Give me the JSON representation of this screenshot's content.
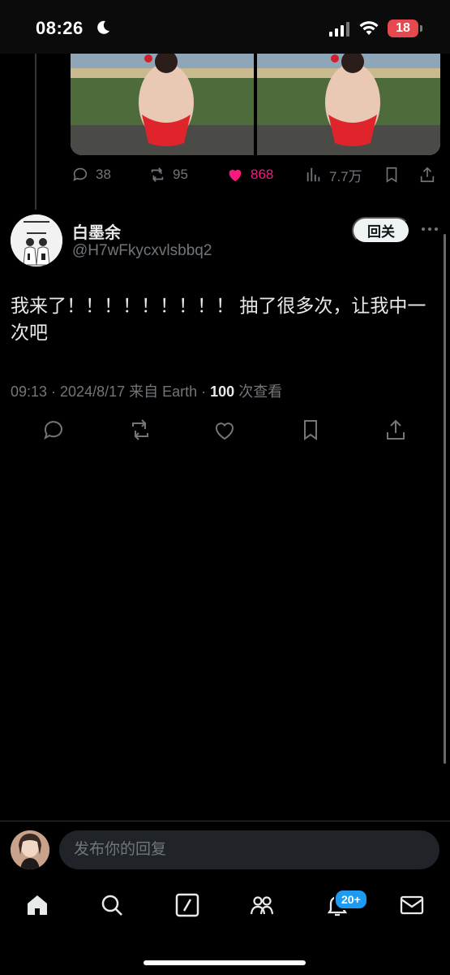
{
  "status_bar": {
    "time": "08:26",
    "battery": "18",
    "icons": [
      "moon-icon",
      "signal-icon",
      "wifi-icon",
      "battery-icon"
    ]
  },
  "previous_tweet": {
    "images": [
      "photo",
      "photo"
    ],
    "actions": {
      "replies": "38",
      "retweets": "95",
      "likes": "868",
      "views": "7.7万"
    }
  },
  "tweet": {
    "display_name": "白墨余",
    "handle": "@H7wFkycxvlsbbq2",
    "follow_back_label": "回关",
    "text": "我来了！！！！！！！！！ 抽了很多次，让我中一次吧",
    "meta_prefix": "09:13 · 2024/8/17 来自 Earth · ",
    "view_count": "100",
    "views_suffix": " 次查看"
  },
  "composer": {
    "placeholder": "发布你的回复"
  },
  "bottom_nav": {
    "items": [
      "home-icon",
      "search-icon",
      "grok-icon",
      "communities-icon",
      "notifications-icon",
      "messages-icon"
    ],
    "notification_badge": "20+"
  },
  "colors": {
    "background": "#000000",
    "text": "#e7e9ea",
    "secondary_text": "#71767b",
    "like_pink": "#f91880",
    "badge_blue": "#1d9bf0"
  }
}
